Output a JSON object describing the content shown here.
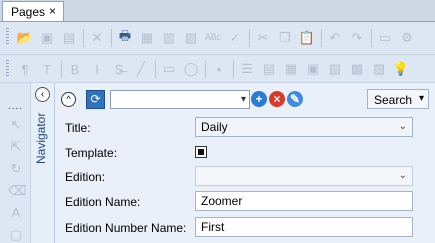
{
  "tab": {
    "label": "Pages",
    "close": "×"
  },
  "toolbar1": {
    "buttons": [
      {
        "name": "open-folder-icon",
        "glyph": "📂",
        "active": true
      },
      {
        "name": "save-icon",
        "glyph": "▣",
        "active": false
      },
      {
        "name": "save-all-icon",
        "glyph": "▤",
        "active": false
      },
      {
        "name": "cut-disabled-icon",
        "glyph": "✕",
        "active": false
      },
      {
        "name": "print-icon",
        "glyph": "🖶",
        "active": true
      },
      {
        "name": "form-icon",
        "glyph": "▦",
        "active": false
      },
      {
        "name": "document-icon",
        "glyph": "▥",
        "active": false
      },
      {
        "name": "export-icon",
        "glyph": "▧",
        "active": false
      },
      {
        "name": "spellcheck-icon",
        "glyph": "ᴬᴮᶜ",
        "active": false
      },
      {
        "name": "check-icon",
        "glyph": "✓",
        "active": false
      },
      {
        "name": "scissors-icon",
        "glyph": "✂",
        "active": false
      },
      {
        "name": "copy-icon",
        "glyph": "❐",
        "active": false
      },
      {
        "name": "paste-icon",
        "glyph": "📋",
        "active": false
      },
      {
        "name": "undo-icon",
        "glyph": "↶",
        "active": false
      },
      {
        "name": "redo-icon",
        "glyph": "↷",
        "active": false
      },
      {
        "name": "panel-icon",
        "glyph": "▭",
        "active": false
      },
      {
        "name": "settings-icon",
        "glyph": "⚙",
        "active": false
      }
    ]
  },
  "toolbar2": {
    "buttons": [
      {
        "name": "paragraph-icon",
        "glyph": "¶",
        "active": false
      },
      {
        "name": "text-icon",
        "glyph": "T",
        "active": false
      },
      {
        "name": "bold-icon",
        "glyph": "B",
        "active": false
      },
      {
        "name": "italic-icon",
        "glyph": "I",
        "active": false
      },
      {
        "name": "strikethrough-icon",
        "glyph": "S̶",
        "active": false
      },
      {
        "name": "line-icon",
        "glyph": "╱",
        "active": false
      },
      {
        "name": "rectangle-icon",
        "glyph": "▭",
        "active": false
      },
      {
        "name": "ellipse-icon",
        "glyph": "◯",
        "active": false
      },
      {
        "name": "bullet-icon",
        "glyph": "•",
        "active": false
      },
      {
        "name": "list-icon",
        "glyph": "☰",
        "active": false
      },
      {
        "name": "number-list-icon",
        "glyph": "▤",
        "active": false
      },
      {
        "name": "table-icon",
        "glyph": "▦",
        "active": false
      },
      {
        "name": "frame-icon",
        "glyph": "▣",
        "active": false
      },
      {
        "name": "image-icon",
        "glyph": "▨",
        "active": false
      },
      {
        "name": "picture-icon",
        "glyph": "▩",
        "active": false
      },
      {
        "name": "gallery-icon",
        "glyph": "▧",
        "active": false
      },
      {
        "name": "lightbulb-icon",
        "glyph": "💡",
        "active": false
      }
    ]
  },
  "side_tools": [
    {
      "name": "pointer-icon",
      "glyph": "↖"
    },
    {
      "name": "select-icon",
      "glyph": "⇱"
    },
    {
      "name": "rotate-icon",
      "glyph": "↻"
    },
    {
      "name": "eraser-icon",
      "glyph": "⌫"
    },
    {
      "name": "text-frame-icon",
      "glyph": "A"
    },
    {
      "name": "shape-icon",
      "glyph": "▢"
    }
  ],
  "navigator": {
    "label": "Navigator",
    "collapse_glyph": "‹"
  },
  "panel": {
    "collapse_glyph": "^",
    "refresh_glyph": "⟳",
    "combo_value": "",
    "add_glyph": "+",
    "remove_glyph": "×",
    "edit_glyph": "✎",
    "search_label": "Search",
    "colors": {
      "add": "#2a7ad8",
      "remove": "#d83a2a",
      "edit": "#3f8be0"
    },
    "fields": [
      {
        "label": "Title:",
        "value": "Daily",
        "type": "select"
      },
      {
        "label": "Template:",
        "checked": true,
        "type": "checkbox"
      },
      {
        "label": "Edition:",
        "value": "",
        "type": "select-disabled"
      },
      {
        "label": "Edition Name:",
        "value": "Zoomer",
        "type": "text"
      },
      {
        "label": "Edition Number Name:",
        "value": "First",
        "type": "text"
      }
    ]
  }
}
